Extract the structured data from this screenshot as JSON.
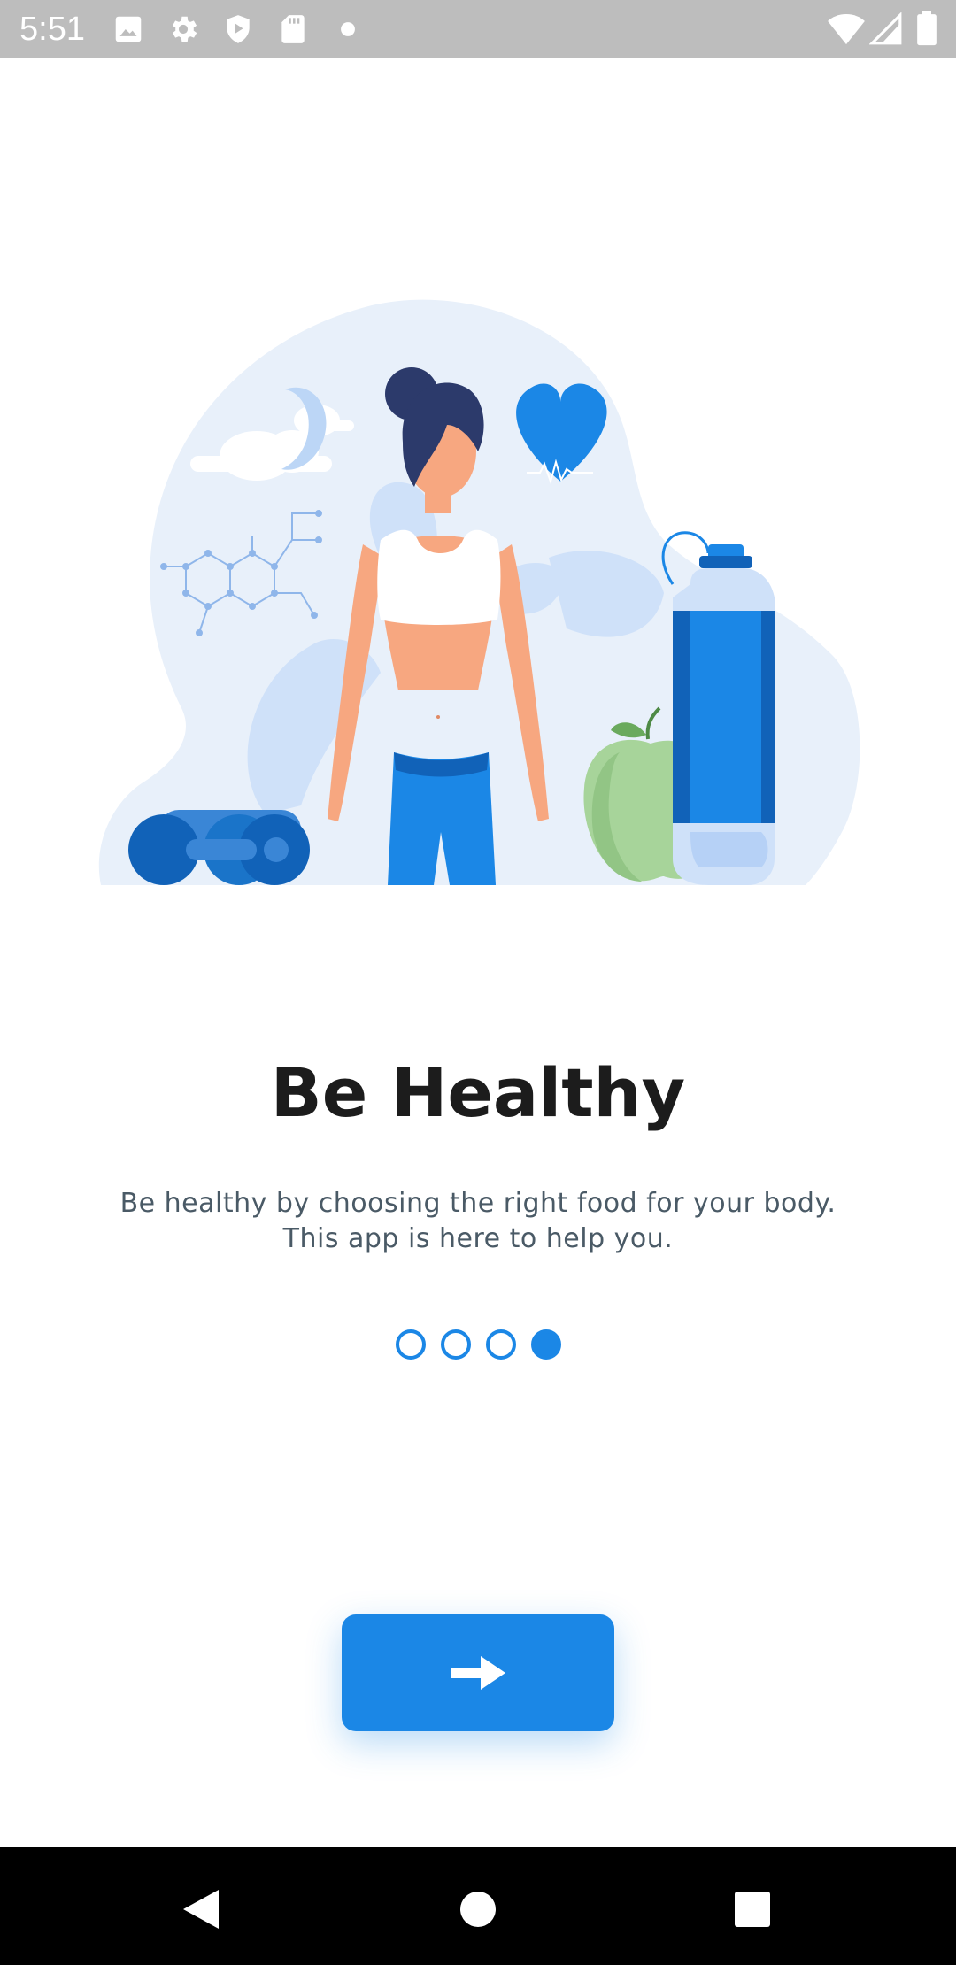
{
  "status_bar": {
    "time": "5:51",
    "left_icons": [
      "image-icon",
      "gear-icon",
      "shield-play-icon",
      "sd-card-icon",
      "dot-icon"
    ],
    "right_icons": [
      "wifi-icon",
      "cell-signal-icon",
      "battery-icon"
    ]
  },
  "onboarding": {
    "title": "Be Healthy",
    "description_line1": "Be healthy by choosing the right food for your body.",
    "description_line2": "This app is here to help you.",
    "page_count": 4,
    "current_page": 4
  },
  "buttons": {
    "next_icon": "arrow-right-icon"
  },
  "nav_bar": {
    "icons": [
      "back-icon",
      "home-icon",
      "recents-icon"
    ]
  },
  "colors": {
    "accent": "#1b87e6",
    "title": "#1c1c1c",
    "subtitle": "#4a5a66",
    "illustration_bg": "#e8f0fa"
  }
}
